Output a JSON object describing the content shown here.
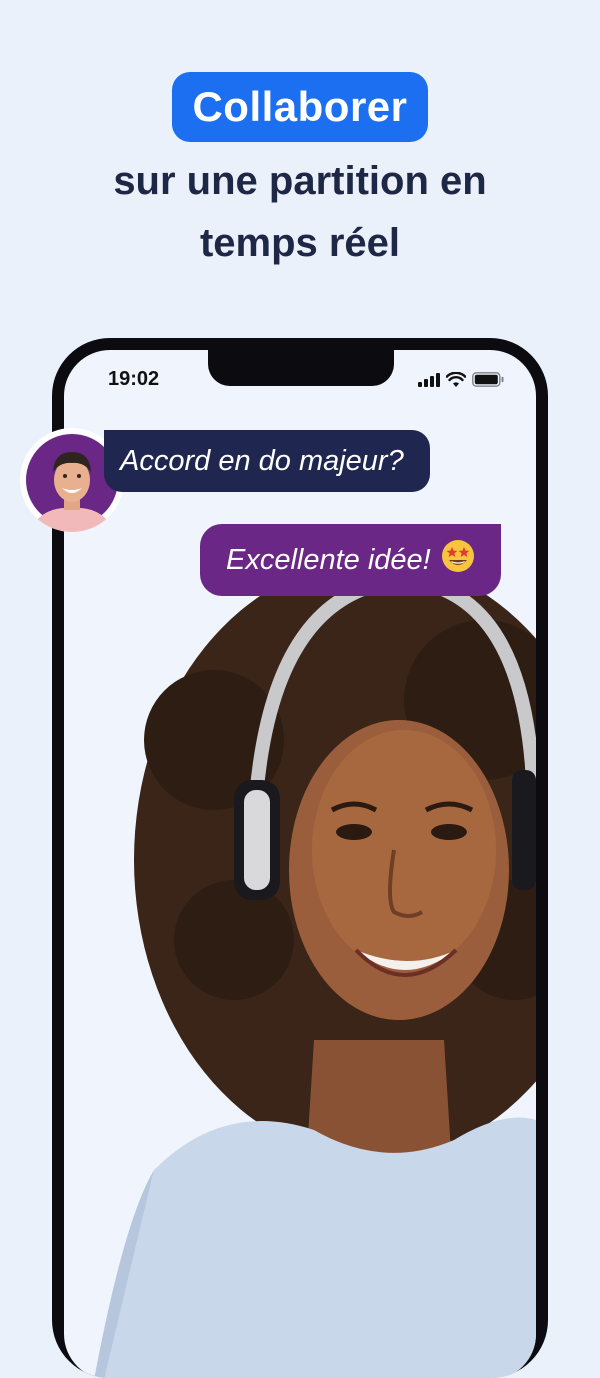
{
  "headline": {
    "highlight": "Collaborer",
    "line1": "sur une partition en",
    "line2": "temps réel"
  },
  "status_bar": {
    "time": "19:02",
    "icons": [
      "signal-icon",
      "wifi-icon",
      "battery-icon"
    ]
  },
  "chat": {
    "message_1": "Accord en do majeur?",
    "message_2": "Excellente idée!",
    "emoji_icon": "star-struck-emoji-icon"
  },
  "colors": {
    "background": "#eaf1fb",
    "accent_blue": "#1c6ff0",
    "headline_text": "#1e2846",
    "bubble_navy": "#1f2750",
    "bubble_purple": "#6a2786"
  }
}
